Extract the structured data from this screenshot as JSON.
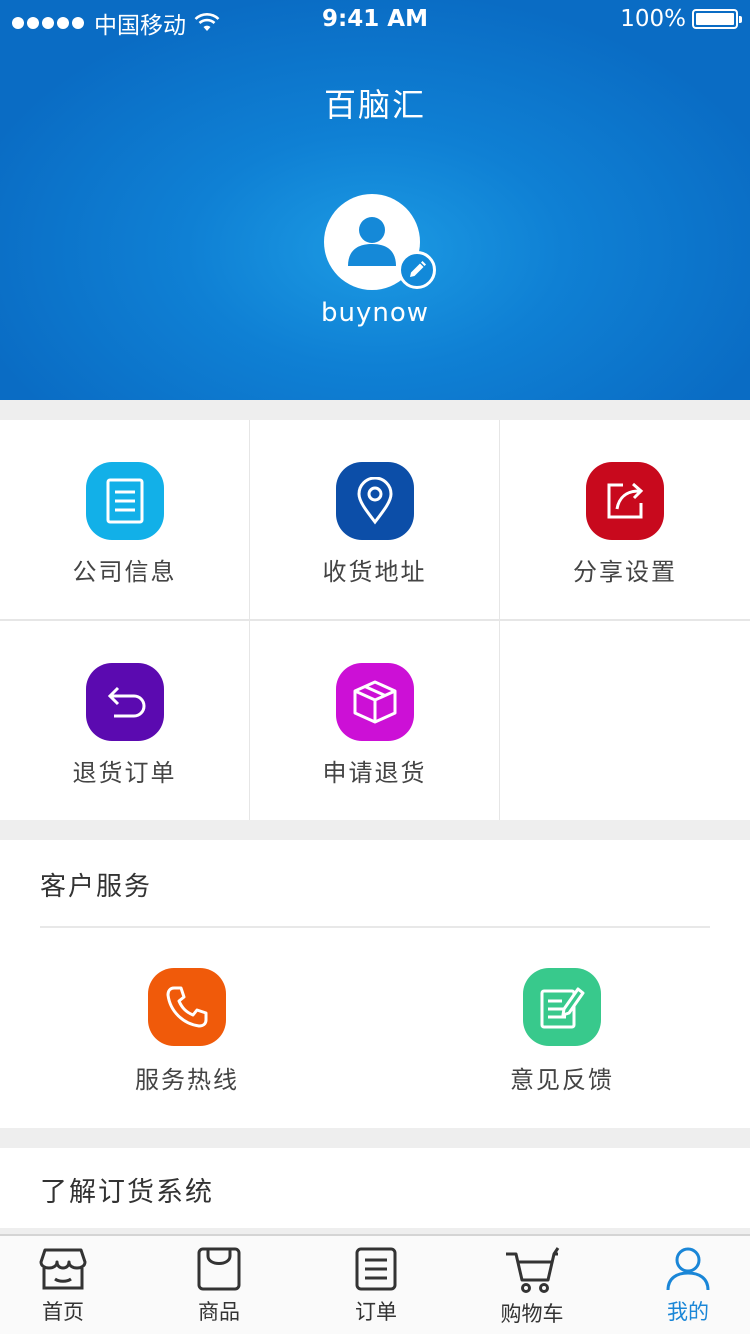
{
  "status_bar": {
    "carrier": "中国移动",
    "time": "9:41 AM",
    "battery": "100%",
    "battery_level": 1.0
  },
  "header": {
    "title": "百脑汇",
    "username": "buynow"
  },
  "grid": [
    {
      "label": "公司信息",
      "icon": "document-icon",
      "color": "#12b0e8"
    },
    {
      "label": "收货地址",
      "icon": "location-pin-icon",
      "color": "#0c4ea8"
    },
    {
      "label": "分享设置",
      "icon": "share-icon",
      "color": "#c8091d"
    },
    {
      "label": "退货订单",
      "icon": "return-arrow-icon",
      "color": "#5b0ab0"
    },
    {
      "label": "申请退货",
      "icon": "box-icon",
      "color": "#cc10d6"
    }
  ],
  "service": {
    "title": "客户服务",
    "items": [
      {
        "label": "服务热线",
        "icon": "phone-icon",
        "color": "#f05a0a"
      },
      {
        "label": "意见反馈",
        "icon": "feedback-icon",
        "color": "#38c98c"
      }
    ]
  },
  "learn": {
    "title": "了解订货系统"
  },
  "tabbar": {
    "tabs": [
      {
        "label": "首页",
        "icon": "store-icon",
        "active": false
      },
      {
        "label": "商品",
        "icon": "bag-icon",
        "active": false
      },
      {
        "label": "订单",
        "icon": "order-list-icon",
        "active": false
      },
      {
        "label": "购物车",
        "icon": "cart-icon",
        "active": false
      },
      {
        "label": "我的",
        "icon": "user-icon",
        "active": true
      }
    ],
    "active_color": "#1a86d7"
  }
}
